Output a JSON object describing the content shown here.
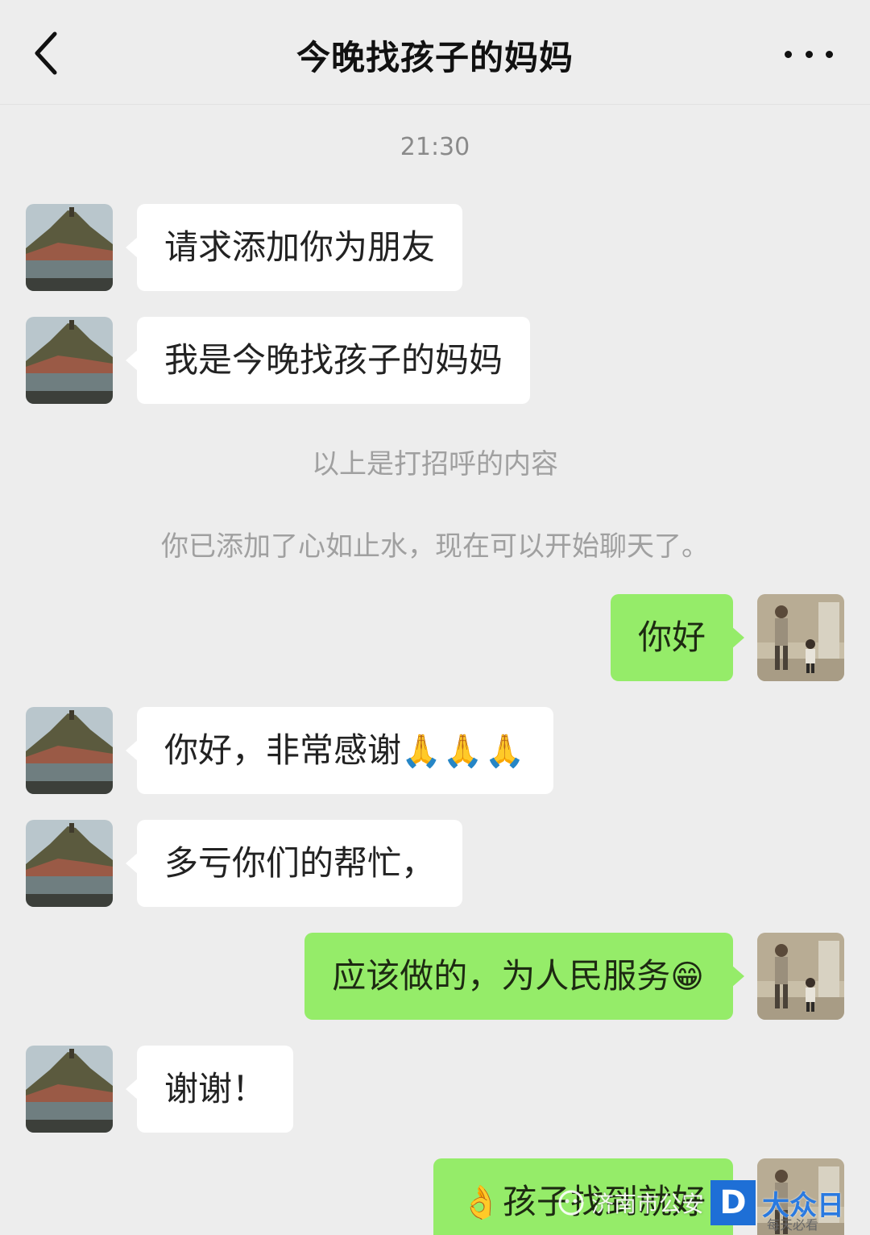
{
  "header": {
    "title": "今晚找孩子的妈妈"
  },
  "chat": {
    "timestamp": "21:30",
    "messages": [
      {
        "text": "请求添加你为朋友"
      },
      {
        "text": "我是今晚找孩子的妈妈"
      },
      {
        "text": "你好"
      },
      {
        "text": "你好，非常感谢",
        "emoji": "🙏🙏🙏"
      },
      {
        "text": "多亏你们的帮忙，"
      },
      {
        "text": "应该做的，为人民服务",
        "emoji": "😁"
      },
      {
        "text": "谢谢！"
      },
      {
        "text": "孩子找到就好",
        "emoji": "👌"
      }
    ],
    "system_notes": [
      "以上是打招呼的内容",
      "你已添加了心如止水，现在可以开始聊天了。"
    ]
  },
  "watermark": {
    "source": "济南市公安",
    "logo_letter": "D",
    "brand": "大众日",
    "sub": "每天必看"
  },
  "colors": {
    "background": "#ededed",
    "incoming_bubble": "#ffffff",
    "outgoing_bubble": "#95ec69"
  }
}
